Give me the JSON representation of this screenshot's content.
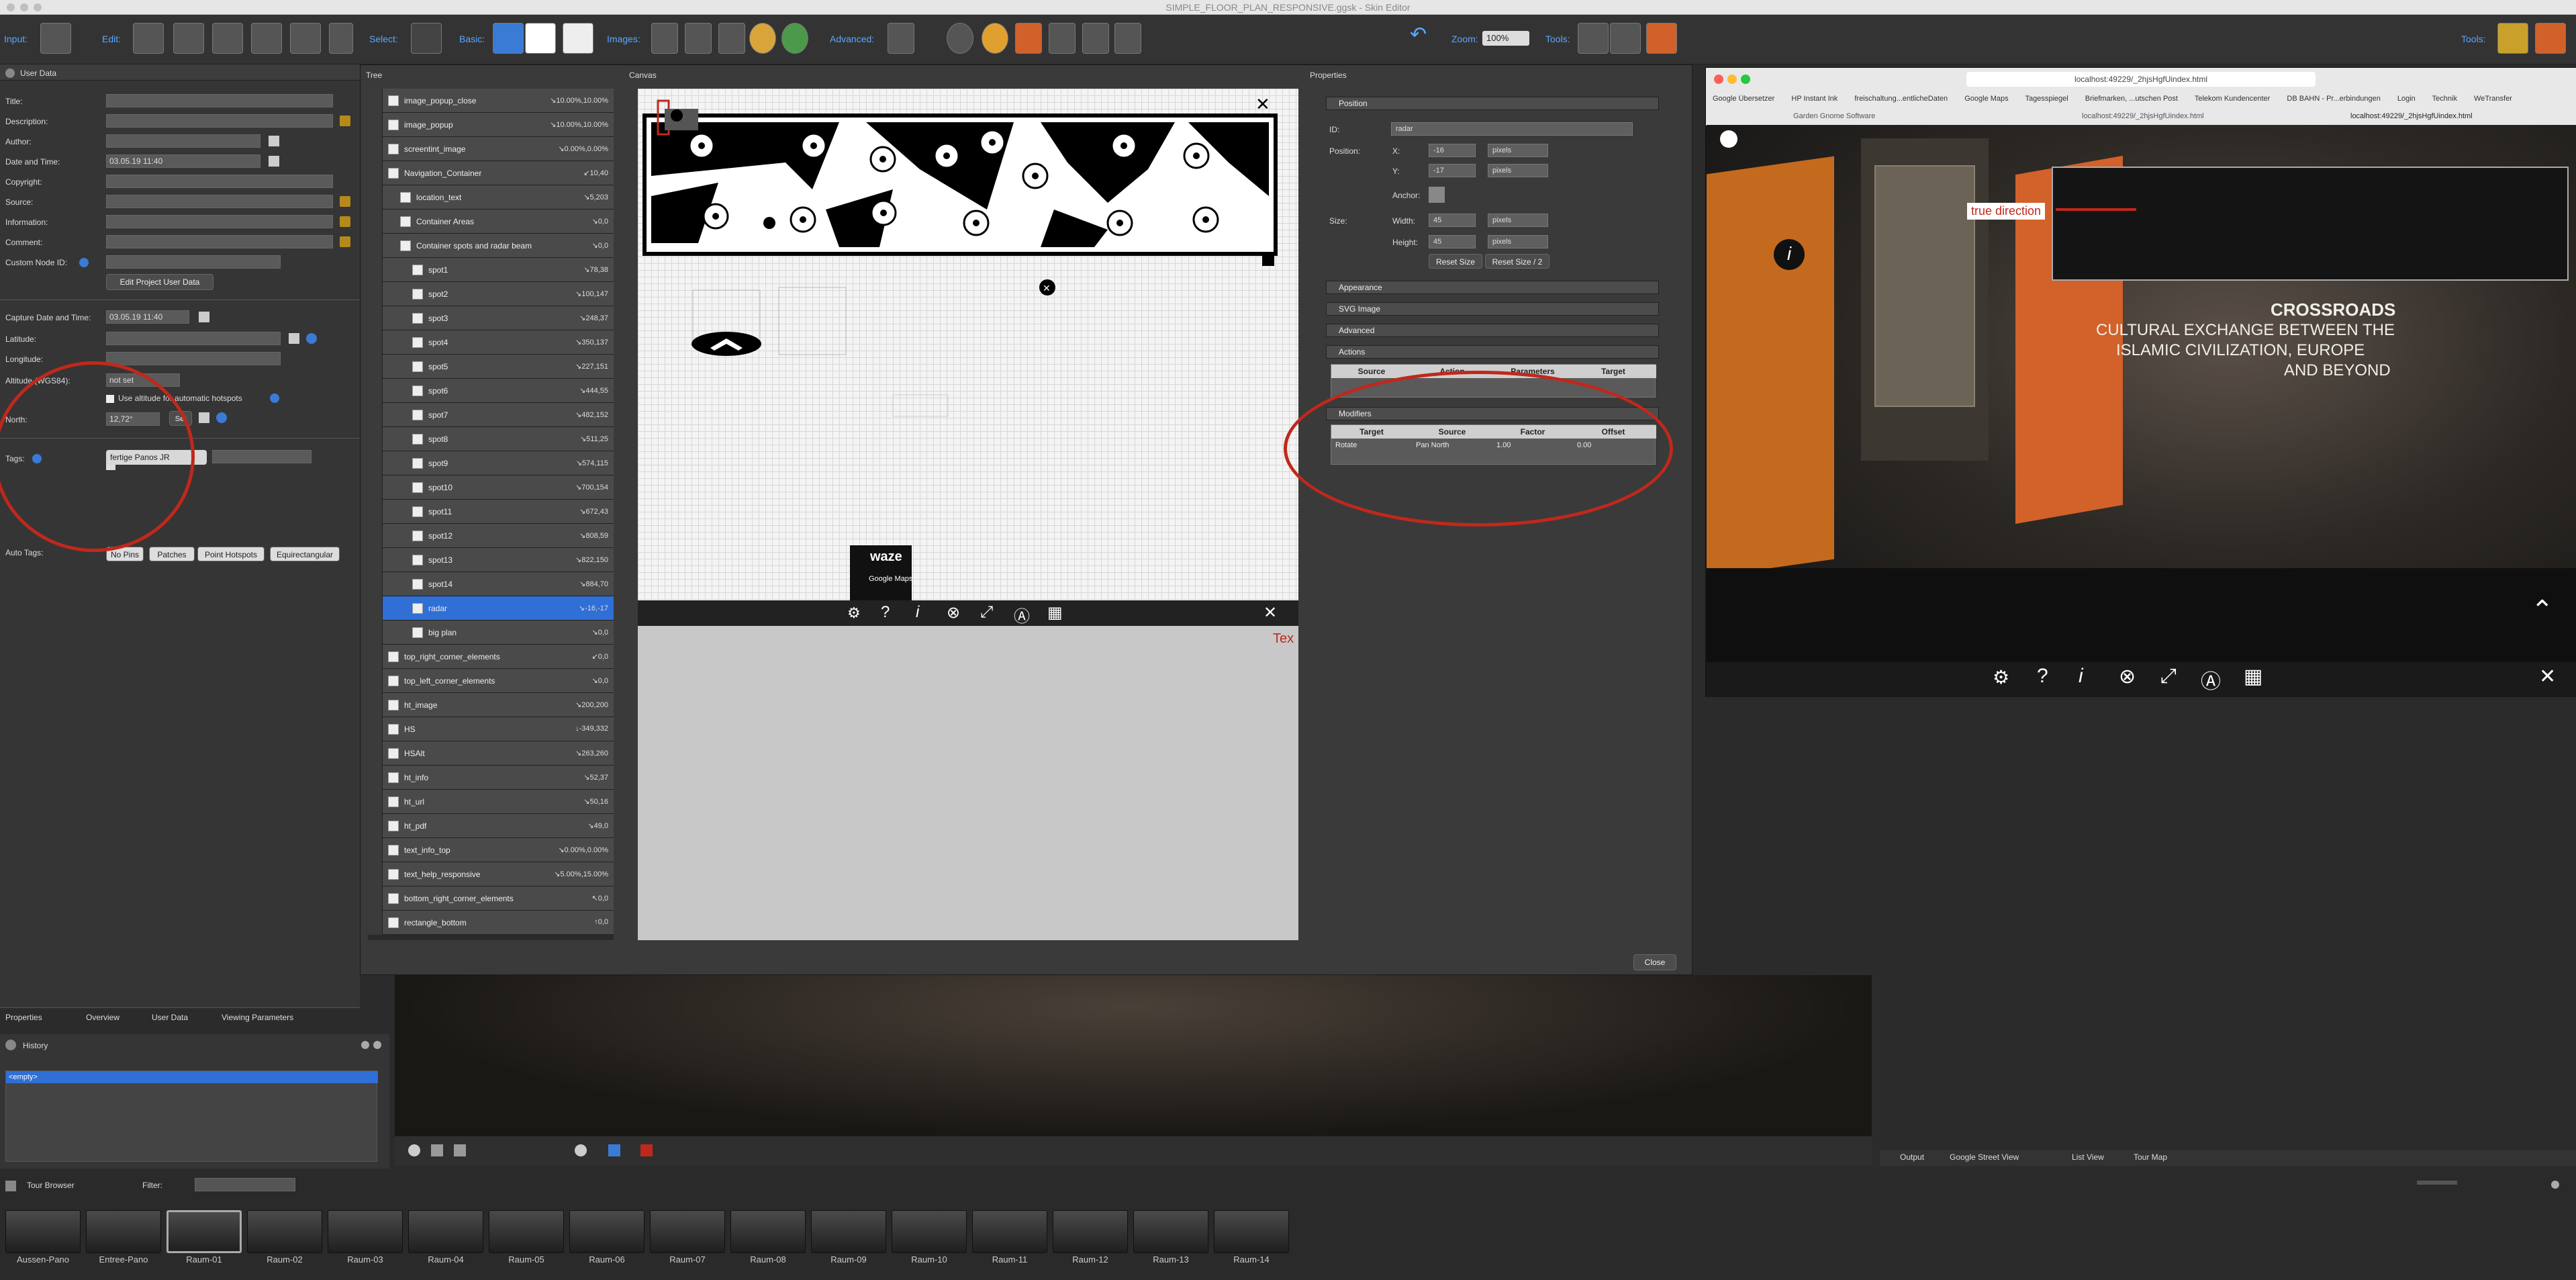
{
  "window_title": "SIMPLE_FLOOR_PLAN_RESPONSIVE.ggsk - Skin Editor",
  "toolbar": {
    "input": "Input:",
    "edit": "Edit:",
    "select": "Select:",
    "basic": "Basic:",
    "images": "Images:",
    "advanced": "Advanced:",
    "zoom": "Zoom:",
    "zoom_value": "100%",
    "tools": "Tools:",
    "tools_right": "Tools:"
  },
  "userdata": {
    "header": "User Data",
    "title": "Title:",
    "description": "Description:",
    "author": "Author:",
    "datetime": "Date and Time:",
    "datetime_value": "03.05.19 11:40",
    "copyright": "Copyright:",
    "source": "Source:",
    "information": "Information:",
    "comment": "Comment:",
    "custom_node_id": "Custom Node ID:",
    "edit_project_btn": "Edit Project User Data",
    "capture_dt": "Capture Date and Time:",
    "capture_dt_value": "03.05.19 11:40",
    "latitude": "Latitude:",
    "longitude": "Longitude:",
    "altitude": "Altitude (WGS84):",
    "altitude_value": "not set",
    "use_altitude": "Use altitude for automatic hotspots",
    "north": "North:",
    "north_value": "12,72°",
    "set_label": "Set",
    "tags": "Tags:",
    "tag1": "fertige Panos JR",
    "autotags": "Auto Tags:",
    "autotag1": "No Pins",
    "autotag2": "Patches",
    "autotag3": "Point Hotspots",
    "autotag4": "Equirectangular"
  },
  "left_tabs": [
    "Properties",
    "Overview",
    "User Data",
    "Viewing Parameters"
  ],
  "history": {
    "title": "History",
    "item": "<empty>"
  },
  "tree": {
    "title": "Tree",
    "rows": [
      {
        "name": "image_popup_close",
        "pos": "↘10.00%,10.00%"
      },
      {
        "name": "image_popup",
        "pos": "↘10.00%,10.00%"
      },
      {
        "name": "screentint_image",
        "pos": "↘0.00%,0.00%"
      },
      {
        "name": "Navigation_Container",
        "pos": "↙10,40"
      },
      {
        "name": "location_text",
        "pos": "↘5,203"
      },
      {
        "name": "Container Areas",
        "pos": "↘0,0"
      },
      {
        "name": "Container spots and radar beam",
        "pos": "↘0,0"
      },
      {
        "name": "spot1",
        "pos": "↘78,38"
      },
      {
        "name": "spot2",
        "pos": "↘100,147"
      },
      {
        "name": "spot3",
        "pos": "↘248,37"
      },
      {
        "name": "spot4",
        "pos": "↘350,137"
      },
      {
        "name": "spot5",
        "pos": "↘227,151"
      },
      {
        "name": "spot6",
        "pos": "↘444,55"
      },
      {
        "name": "spot7",
        "pos": "↘482,152"
      },
      {
        "name": "spot8",
        "pos": "↘511,25"
      },
      {
        "name": "spot9",
        "pos": "↘574,115"
      },
      {
        "name": "spot10",
        "pos": "↘700,154"
      },
      {
        "name": "spot11",
        "pos": "↘672,43"
      },
      {
        "name": "spot12",
        "pos": "↘808,59"
      },
      {
        "name": "spot13",
        "pos": "↘822,150"
      },
      {
        "name": "spot14",
        "pos": "↘884,70"
      },
      {
        "name": "radar",
        "pos": "↘-16,-17"
      },
      {
        "name": "big plan",
        "pos": "↘0,0"
      },
      {
        "name": "top_right_corner_elements",
        "pos": "↙0,0"
      },
      {
        "name": "top_left_corner_elements",
        "pos": "↘0,0"
      },
      {
        "name": "ht_image",
        "pos": "↘200,200"
      },
      {
        "name": "HS",
        "pos": "↓-349,332"
      },
      {
        "name": "HSAlt",
        "pos": "↘263,260"
      },
      {
        "name": "ht_info",
        "pos": "↘52,37"
      },
      {
        "name": "ht_url",
        "pos": "↘50,16"
      },
      {
        "name": "ht_pdf",
        "pos": "↘49,0"
      },
      {
        "name": "text_info_top",
        "pos": "↘0.00%,0.00%"
      },
      {
        "name": "text_help_responsive",
        "pos": "↘5.00%,15.00%"
      },
      {
        "name": "bottom_right_corner_elements",
        "pos": "↖0,0"
      },
      {
        "name": "rectangle_bottom",
        "pos": "↑0,0"
      }
    ]
  },
  "canvas": {
    "title": "Canvas",
    "waze": "waze",
    "gmaps": "Google Maps",
    "red_text": "Tex"
  },
  "props": {
    "title": "Properties",
    "position": "Position",
    "id_label": "ID:",
    "id_value": "radar",
    "position_label": "Position:",
    "x_label": "X:",
    "x_value": "-16",
    "y_label": "Y:",
    "y_value": "-17",
    "unit": "pixels",
    "anchor": "Anchor:",
    "size_label": "Size:",
    "width_label": "Width:",
    "width_value": "45",
    "height_label": "Height:",
    "height_value": "45",
    "reset_size": "Reset Size",
    "reset_size2": "Reset Size / 2",
    "appearance": "Appearance",
    "svg_image": "SVG Image",
    "advanced": "Advanced",
    "actions": "Actions",
    "actions_cols": [
      "Source",
      "Action",
      "Parameters",
      "Target"
    ],
    "modifiers": "Modifiers",
    "mod_cols": [
      "Target",
      "Source",
      "Factor",
      "Offset"
    ],
    "mod_row": [
      "Rotate",
      "Pan North",
      "1.00",
      "0.00"
    ]
  },
  "close_btn": "Close",
  "browser": {
    "url": "localhost:49229/_2hjsHgfUindex.html",
    "bookmarks": [
      "Google Übersetzer",
      "HP Instant Ink",
      "freischaltung...entlicheDaten",
      "Google Maps",
      "Tagesspiegel",
      "Briefmarken, ...utschen Post",
      "Telekom Kundencenter",
      "DB BAHN - Pr...erbindungen",
      "Login",
      "Technik",
      "WeTransfer"
    ],
    "tabs": [
      "Garden Gnome Software",
      "localhost:49229/_2hjsHgfUindex.html",
      "localhost:49229/_2hjsHgfUindex.html"
    ],
    "annotation": "true direction",
    "wall_title": "CROSSROADS",
    "wall_line1": "CULTURAL EXCHANGE BETWEEN THE",
    "wall_line2": "ISLAMIC CIVILIZATION, EUROPE",
    "wall_line3": "AND BEYOND"
  },
  "output_tabs": [
    "Output",
    "Google Street View",
    "List View",
    "Tour Map"
  ],
  "tourbrowser": {
    "title": "Tour Browser",
    "filter": "Filter:",
    "items": [
      "Aussen-Pano",
      "Entree-Pano",
      "Raum-01",
      "Raum-02",
      "Raum-03",
      "Raum-04",
      "Raum-05",
      "Raum-06",
      "Raum-07",
      "Raum-08",
      "Raum-09",
      "Raum-10",
      "Raum-11",
      "Raum-12",
      "Raum-13",
      "Raum-14"
    ]
  },
  "colors": {
    "accent": "#2f6fd6",
    "annotation_red": "#c0281c"
  }
}
